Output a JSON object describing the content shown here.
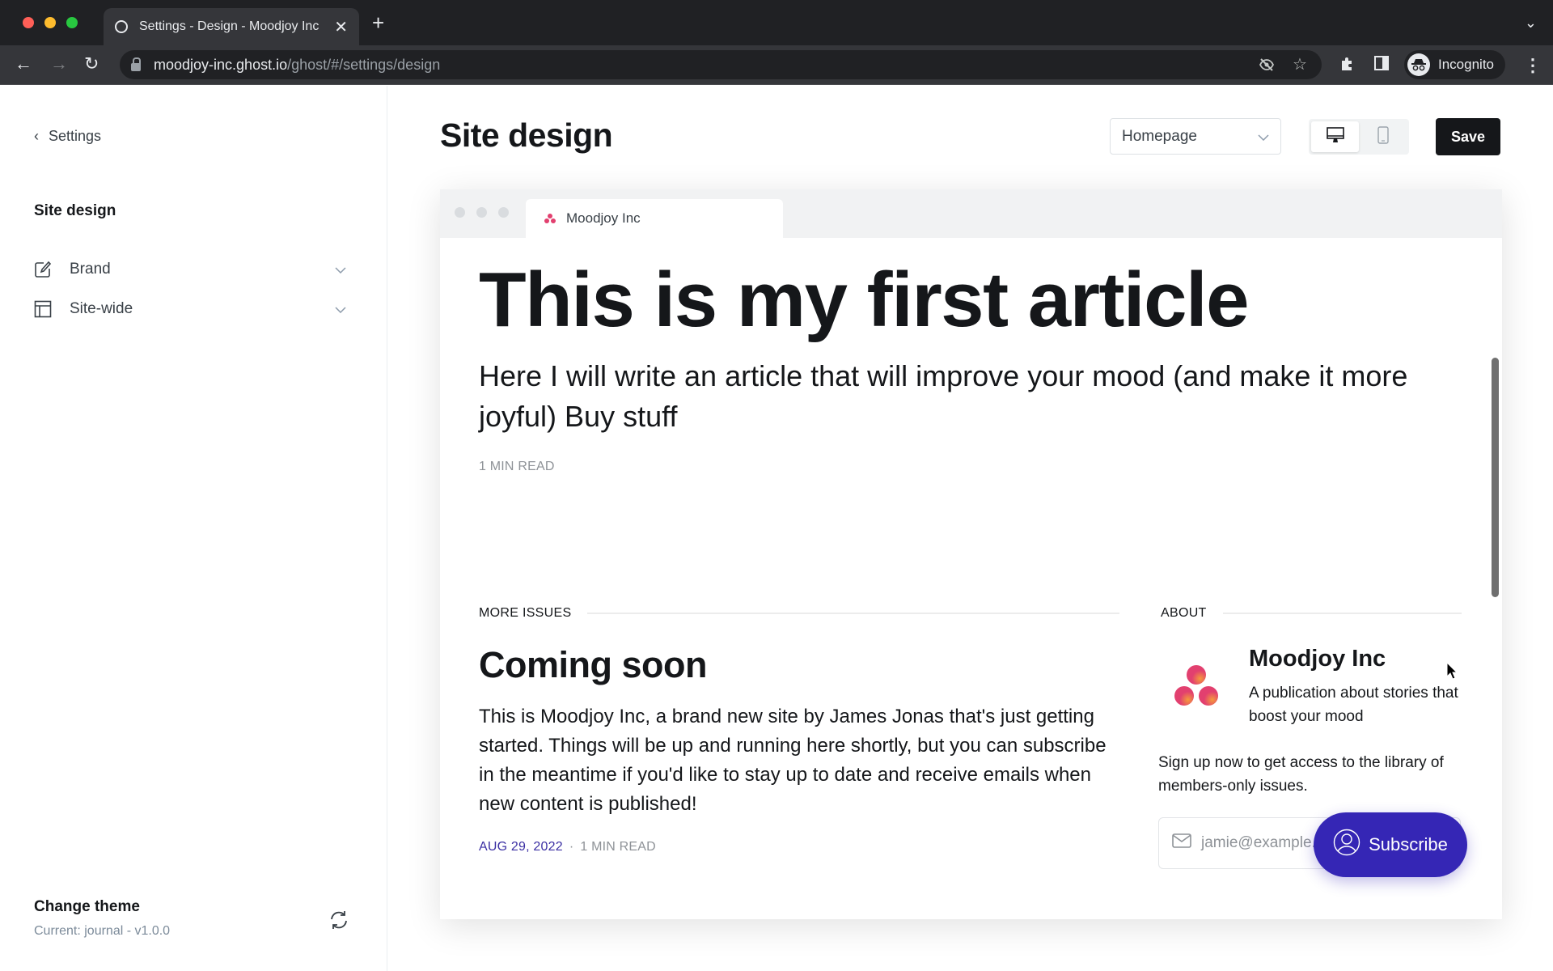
{
  "browser": {
    "tab_title": "Settings - Design - Moodjoy Inc",
    "url_host": "moodjoy-inc.ghost.io",
    "url_path": "/ghost/#/settings/design",
    "profile_label": "Incognito",
    "icons": [
      "back-icon",
      "forward-icon",
      "reload-icon",
      "lock-icon",
      "eye-off-icon",
      "star-icon",
      "extensions-icon",
      "sidepanel-icon",
      "incognito-icon",
      "menu-icon"
    ]
  },
  "sidebar": {
    "back_label": "Settings",
    "section_title": "Site design",
    "items": [
      {
        "label": "Brand",
        "icon": "brand-edit-icon"
      },
      {
        "label": "Site-wide",
        "icon": "layout-icon"
      }
    ],
    "theme": {
      "title": "Change theme",
      "current": "Current: journal - v1.0.0"
    }
  },
  "header": {
    "title": "Site design",
    "page_select": "Homepage",
    "device_options": [
      "desktop",
      "mobile"
    ],
    "device_selected": "desktop",
    "save_label": "Save"
  },
  "preview": {
    "tab_label": "Moodjoy Inc",
    "article": {
      "title": "This is my first article",
      "excerpt": "Here I will write an article that will improve your mood (and make it more joyful) Buy stuff",
      "meta": "1 MIN READ"
    },
    "more_issues": {
      "heading": "MORE ISSUES",
      "post_title": "Coming soon",
      "post_body": "This is Moodjoy Inc, a brand new site by James Jonas that's just getting started. Things will be up and running here shortly, but you can subscribe in the meantime if you'd like to stay up to date and receive emails when new content is published!",
      "date": "AUG 29, 2022",
      "separator": "·",
      "read_time": "1 MIN READ"
    },
    "about": {
      "heading": "ABOUT",
      "name": "Moodjoy Inc",
      "description": "A publication about stories that boost your mood",
      "cta": "Sign up now to get access to the library of members-only issues.",
      "email_placeholder": "jamie@example.com"
    },
    "subscribe_label": "Subscribe",
    "colors": {
      "accent": "#3526b5",
      "date": "#3b2fa3",
      "logo": "#e2406f"
    }
  }
}
